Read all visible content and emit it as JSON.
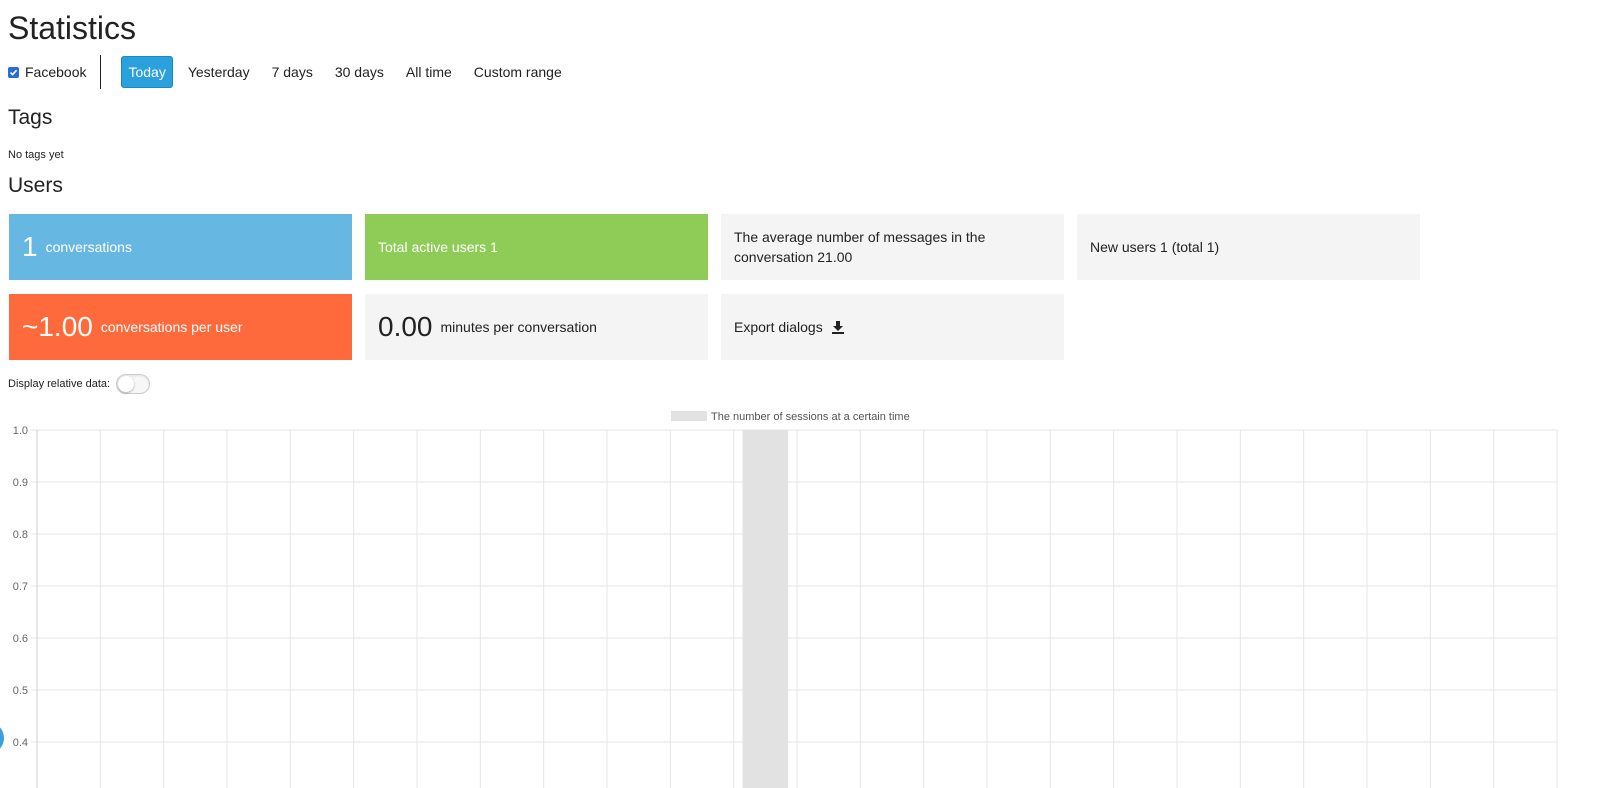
{
  "page": {
    "title": "Statistics"
  },
  "filters": {
    "channel": {
      "label": "Facebook",
      "checked": true
    },
    "ranges": [
      {
        "label": "Today",
        "active": true
      },
      {
        "label": "Yesterday",
        "active": false
      },
      {
        "label": "7 days",
        "active": false
      },
      {
        "label": "30 days",
        "active": false
      },
      {
        "label": "All time",
        "active": false
      },
      {
        "label": "Custom range",
        "active": false
      }
    ]
  },
  "tags": {
    "title": "Tags",
    "empty_text": "No tags yet"
  },
  "users": {
    "title": "Users",
    "conversations": {
      "value": "1",
      "label": "conversations"
    },
    "active_users": {
      "label": "Total active users 1"
    },
    "avg_messages": {
      "label": "The average number of messages in the conversation 21.00"
    },
    "new_users": {
      "label": "New users 1 (total 1)"
    },
    "per_user": {
      "value": "~1.00",
      "label": "conversations per user"
    },
    "minutes": {
      "value": "0.00",
      "label": "minutes per conversation"
    },
    "export": {
      "label": "Export dialogs",
      "icon": "download-icon"
    }
  },
  "relative_toggle": {
    "label": "Display relative data:",
    "on": false
  },
  "colors": {
    "blue": "#66b8e2",
    "green": "#8fcc57",
    "orange": "#ff6a3d",
    "active_tab": "#2aa0dc",
    "bar": "#e2e2e2"
  },
  "chart_data": {
    "type": "bar",
    "legend": "The number of sessions at a certain time",
    "legend_position": "top-center",
    "grid": true,
    "ylim": [
      0.4,
      1.0
    ],
    "y_ticks": [
      "1.0",
      "0.9",
      "0.8",
      "0.7",
      "0.6",
      "0.5",
      "0.4"
    ],
    "columns": 24,
    "series": [
      {
        "name": "The number of sessions at a certain time",
        "values": [
          0,
          0,
          0,
          0,
          0,
          0,
          0,
          0,
          0,
          0,
          0,
          1,
          0,
          0,
          0,
          0,
          0,
          0,
          0,
          0,
          0,
          0,
          0,
          0
        ]
      }
    ]
  }
}
